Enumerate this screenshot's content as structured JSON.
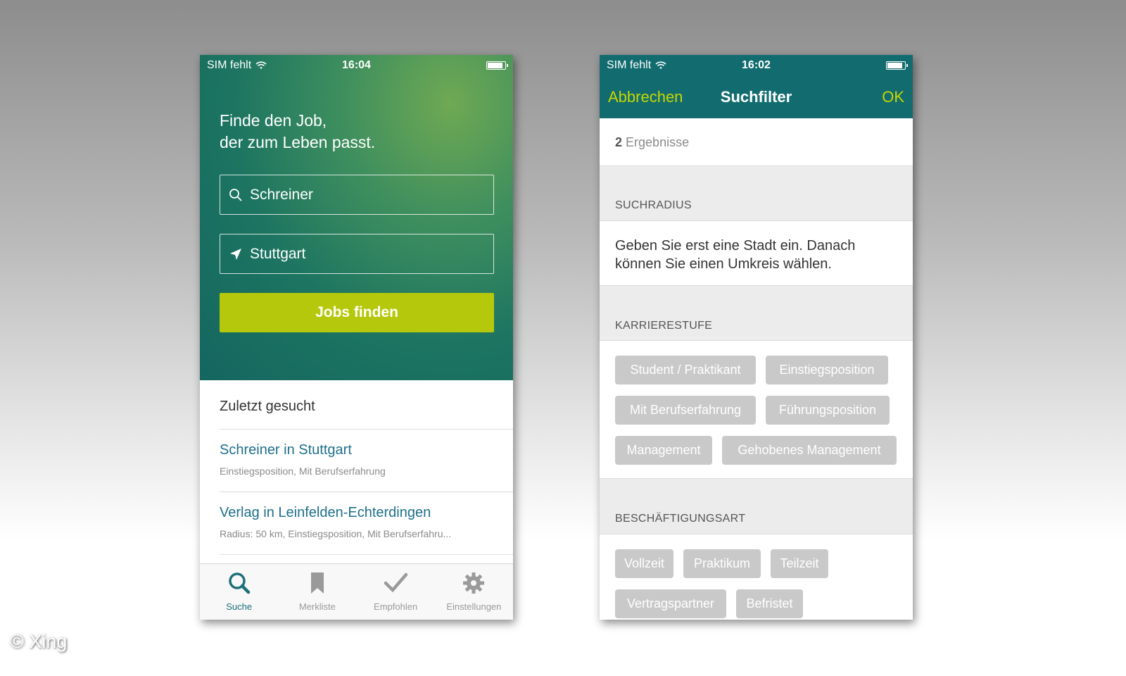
{
  "left_phone": {
    "status": {
      "carrier": "SIM fehlt",
      "time": "16:04"
    },
    "hero": {
      "title_line1": "Finde den Job,",
      "title_line2": "der zum Leben passt.",
      "search_value": "Schreiner",
      "location_value": "Stuttgart",
      "button_label": "Jobs finden"
    },
    "recent": {
      "heading": "Zuletzt gesucht",
      "items": [
        {
          "title": "Schreiner in Stuttgart",
          "subtitle": "Einstiegsposition, Mit Berufserfahrung"
        },
        {
          "title": "Verlag in Leinfelden-Echterdingen",
          "subtitle": "Radius: 50 km, Einstiegsposition, Mit Berufserfahru..."
        }
      ]
    },
    "tabs": [
      {
        "label": "Suche",
        "icon": "search-icon",
        "active": true
      },
      {
        "label": "Merkliste",
        "icon": "bookmark-icon",
        "active": false
      },
      {
        "label": "Empfohlen",
        "icon": "checkmark-icon",
        "active": false
      },
      {
        "label": "Einstellungen",
        "icon": "gear-icon",
        "active": false
      }
    ]
  },
  "right_phone": {
    "status": {
      "carrier": "SIM fehlt",
      "time": "16:02"
    },
    "nav": {
      "cancel": "Abbrechen",
      "title": "Suchfilter",
      "ok": "OK"
    },
    "results": {
      "count": "2",
      "label": "Ergebnisse"
    },
    "radius": {
      "header": "SUCHRADIUS",
      "text_line1": "Geben Sie erst eine Stadt ein. Danach",
      "text_line2": "können Sie einen Umkreis wählen."
    },
    "career": {
      "header": "KARRIERESTUFE",
      "chips": [
        "Student / Praktikant",
        "Einstiegsposition",
        "Mit Berufserfahrung",
        "Führungsposition",
        "Management",
        "Gehobenes Management"
      ]
    },
    "employment": {
      "header": "BESCHÄFTIGUNGSART",
      "chips": [
        "Vollzeit",
        "Praktikum",
        "Teilzeit",
        "Vertragspartner",
        "Befristet"
      ]
    }
  },
  "copyright": "© Xing",
  "colors": {
    "accent_green": "#b5c80b",
    "nav_teal": "#126c6f",
    "link_blue": "#1d6f8c",
    "chip_gray": "#c9c9c9"
  }
}
